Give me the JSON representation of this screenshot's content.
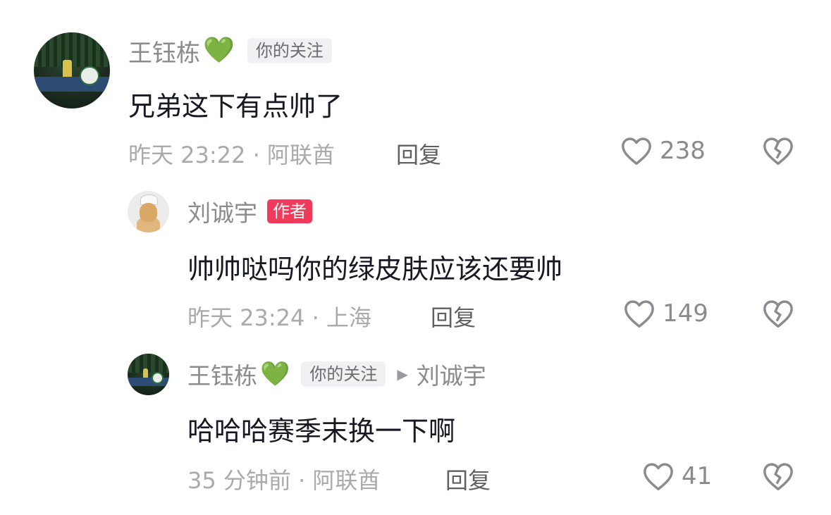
{
  "comments": [
    {
      "name": "王钰栋",
      "emoji": "💚",
      "tag": "你的关注",
      "text": "兄弟这下有点帅了",
      "meta": "昨天 23:22 · 阿联酋",
      "reply_label": "回复",
      "likes": "238"
    },
    {
      "name": "刘诚宇",
      "tag": "作者",
      "text": "帅帅哒吗你的绿皮肤应该还要帅",
      "meta": "昨天 23:24 · 上海",
      "reply_label": "回复",
      "likes": "149"
    },
    {
      "name": "王钰栋",
      "emoji": "💚",
      "tag": "你的关注",
      "reply_to": "刘诚宇",
      "text": "哈哈哈赛季末换一下啊",
      "meta": "35 分钟前 · 阿联酋",
      "reply_label": "回复",
      "likes": "41"
    }
  ],
  "icons": {
    "like": "heart-outline-icon",
    "dislike": "broken-heart-icon",
    "reply_arrow": "triangle-right-icon"
  },
  "colors": {
    "author_tag": "#f13a5a",
    "follow_tag_bg": "#f1f1f3",
    "name": "#8a8a90",
    "meta": "#a9a9ae",
    "text": "#161823"
  }
}
